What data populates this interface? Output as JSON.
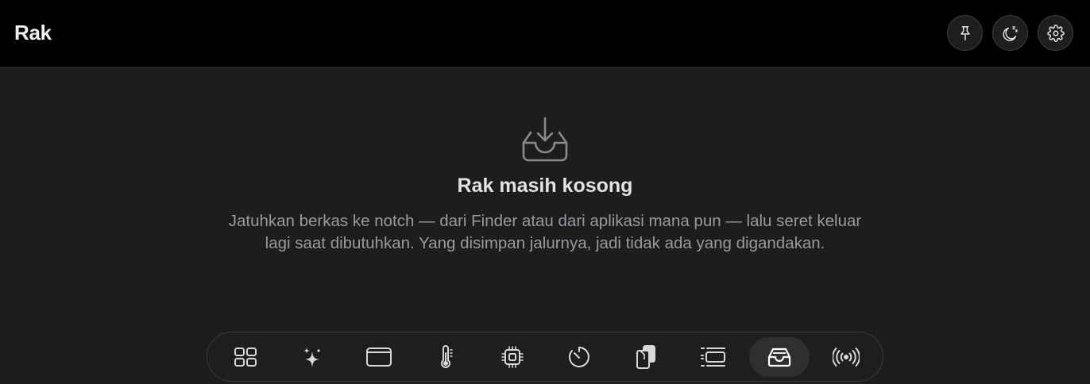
{
  "header": {
    "title": "Rak",
    "buttons": [
      {
        "icon": "pin-icon"
      },
      {
        "icon": "moon-sleep-icon"
      },
      {
        "icon": "gear-icon"
      }
    ]
  },
  "empty_state": {
    "icon": "tray-download-icon",
    "title": "Rak masih kosong",
    "body": "Jatuhkan berkas ke notch — dari Finder atau dari aplikasi mana pun — lalu seret keluar lagi saat dibutuhkan. Yang disimpan jalurnya, jadi tidak ada yang digandakan."
  },
  "dock": {
    "active_index": 8,
    "items": [
      {
        "icon": "grid-icon"
      },
      {
        "icon": "sparkles-icon"
      },
      {
        "icon": "window-icon"
      },
      {
        "icon": "thermometer-icon"
      },
      {
        "icon": "cpu-chip-icon"
      },
      {
        "icon": "timer-icon"
      },
      {
        "icon": "clipboard-icon"
      },
      {
        "icon": "list-panel-icon"
      },
      {
        "icon": "tray-icon"
      },
      {
        "icon": "broadcast-icon"
      }
    ]
  },
  "colors": {
    "header_bg": "#000000",
    "main_bg": "#1d1d1f",
    "text_primary": "#e2e2e2",
    "text_secondary": "#9a9a9e"
  }
}
